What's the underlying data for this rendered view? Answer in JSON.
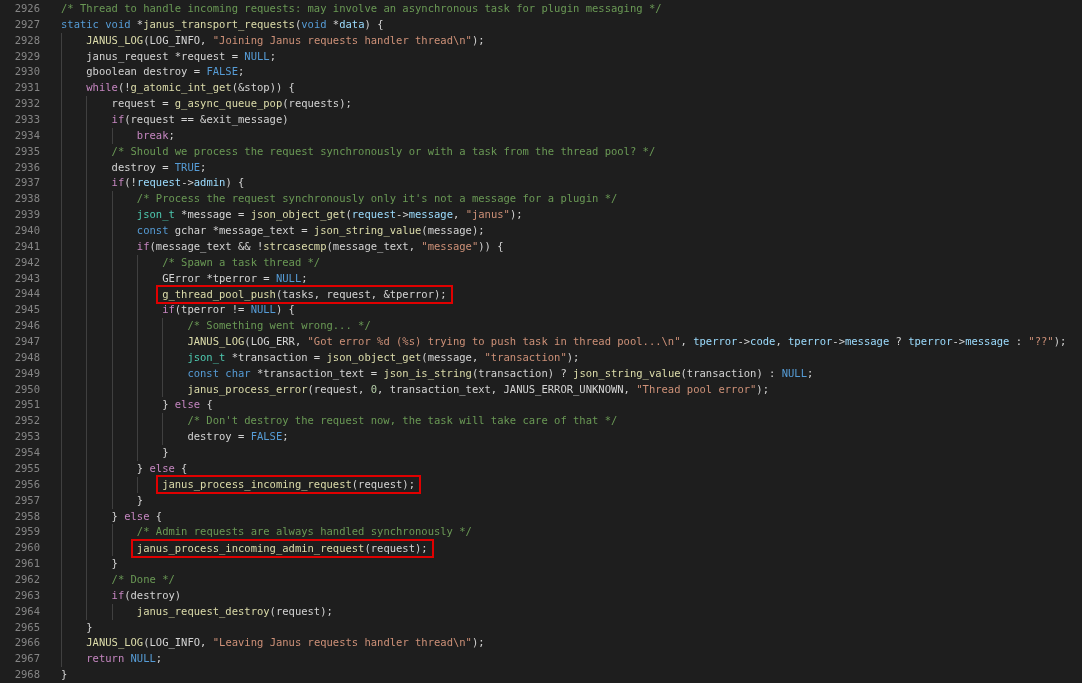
{
  "editor": {
    "lines": [
      {
        "number": "2926",
        "boxed": false,
        "tokens": [
          {
            "kind": "comment",
            "text": "/* Thread to handle incoming requests: may involve an asynchronous task for plugin messaging */"
          }
        ]
      },
      {
        "number": "2927",
        "boxed": false,
        "tokens": [
          {
            "kind": "keyword",
            "text": "static void"
          },
          {
            "kind": "plain",
            "text": " *"
          },
          {
            "kind": "function",
            "text": "janus_transport_requests"
          },
          {
            "kind": "plain",
            "text": "("
          },
          {
            "kind": "keyword",
            "text": "void"
          },
          {
            "kind": "plain",
            "text": " *"
          },
          {
            "kind": "member",
            "text": "data"
          },
          {
            "kind": "plain",
            "text": ") {"
          }
        ],
        "children": [
          {
            "number": "2928",
            "boxed": false,
            "tokens": [
              {
                "kind": "function",
                "text": "JANUS_LOG"
              },
              {
                "kind": "plain",
                "text": "(LOG_INFO, "
              },
              {
                "kind": "string",
                "text": "\"Joining Janus requests handler thread\\n\""
              },
              {
                "kind": "plain",
                "text": ");"
              }
            ]
          },
          {
            "number": "2929",
            "boxed": false,
            "tokens": [
              {
                "kind": "plain",
                "text": "janus_request *request = "
              },
              {
                "kind": "keyword",
                "text": "NULL"
              },
              {
                "kind": "plain",
                "text": ";"
              }
            ]
          },
          {
            "number": "2930",
            "boxed": false,
            "tokens": [
              {
                "kind": "plain",
                "text": "gboolean destroy = "
              },
              {
                "kind": "keyword",
                "text": "FALSE"
              },
              {
                "kind": "plain",
                "text": ";"
              }
            ]
          },
          {
            "number": "2931",
            "boxed": false,
            "tokens": [
              {
                "kind": "control",
                "text": "while"
              },
              {
                "kind": "plain",
                "text": "(!"
              },
              {
                "kind": "function",
                "text": "g_atomic_int_get"
              },
              {
                "kind": "plain",
                "text": "(&stop)) {"
              }
            ],
            "children": [
              {
                "number": "2932",
                "boxed": false,
                "tokens": [
                  {
                    "kind": "plain",
                    "text": "request = "
                  },
                  {
                    "kind": "function",
                    "text": "g_async_queue_pop"
                  },
                  {
                    "kind": "plain",
                    "text": "(requests);"
                  }
                ]
              },
              {
                "number": "2933",
                "boxed": false,
                "tokens": [
                  {
                    "kind": "control",
                    "text": "if"
                  },
                  {
                    "kind": "plain",
                    "text": "(request == &exit_message)"
                  }
                ],
                "children": [
                  {
                    "number": "2934",
                    "boxed": false,
                    "tokens": [
                      {
                        "kind": "control",
                        "text": "break"
                      },
                      {
                        "kind": "plain",
                        "text": ";"
                      }
                    ]
                  }
                ]
              },
              {
                "number": "2935",
                "boxed": false,
                "tokens": [
                  {
                    "kind": "comment",
                    "text": "/* Should we process the request synchronously or with a task from the thread pool? */"
                  }
                ]
              },
              {
                "number": "2936",
                "boxed": false,
                "tokens": [
                  {
                    "kind": "plain",
                    "text": "destroy = "
                  },
                  {
                    "kind": "keyword",
                    "text": "TRUE"
                  },
                  {
                    "kind": "plain",
                    "text": ";"
                  }
                ]
              },
              {
                "number": "2937",
                "boxed": false,
                "tokens": [
                  {
                    "kind": "control",
                    "text": "if"
                  },
                  {
                    "kind": "plain",
                    "text": "(!"
                  },
                  {
                    "kind": "member",
                    "text": "request"
                  },
                  {
                    "kind": "plain",
                    "text": "->"
                  },
                  {
                    "kind": "member",
                    "text": "admin"
                  },
                  {
                    "kind": "plain",
                    "text": ") {"
                  }
                ],
                "children": [
                  {
                    "number": "2938",
                    "boxed": false,
                    "tokens": [
                      {
                        "kind": "comment",
                        "text": "/* Process the request synchronously only it's not a message for a plugin */"
                      }
                    ]
                  },
                  {
                    "number": "2939",
                    "boxed": false,
                    "tokens": [
                      {
                        "kind": "type",
                        "text": "json_t"
                      },
                      {
                        "kind": "plain",
                        "text": " *message = "
                      },
                      {
                        "kind": "function",
                        "text": "json_object_get"
                      },
                      {
                        "kind": "plain",
                        "text": "("
                      },
                      {
                        "kind": "member",
                        "text": "request"
                      },
                      {
                        "kind": "plain",
                        "text": "->"
                      },
                      {
                        "kind": "member",
                        "text": "message"
                      },
                      {
                        "kind": "plain",
                        "text": ", "
                      },
                      {
                        "kind": "string",
                        "text": "\"janus\""
                      },
                      {
                        "kind": "plain",
                        "text": ");"
                      }
                    ]
                  },
                  {
                    "number": "2940",
                    "boxed": false,
                    "tokens": [
                      {
                        "kind": "keyword",
                        "text": "const"
                      },
                      {
                        "kind": "plain",
                        "text": " gchar *message_text = "
                      },
                      {
                        "kind": "function",
                        "text": "json_string_value"
                      },
                      {
                        "kind": "plain",
                        "text": "(message);"
                      }
                    ]
                  },
                  {
                    "number": "2941",
                    "boxed": false,
                    "tokens": [
                      {
                        "kind": "control",
                        "text": "if"
                      },
                      {
                        "kind": "plain",
                        "text": "(message_text && !"
                      },
                      {
                        "kind": "function",
                        "text": "strcasecmp"
                      },
                      {
                        "kind": "plain",
                        "text": "(message_text, "
                      },
                      {
                        "kind": "string",
                        "text": "\"message\""
                      },
                      {
                        "kind": "plain",
                        "text": ")) {"
                      }
                    ],
                    "children": [
                      {
                        "number": "2942",
                        "boxed": false,
                        "tokens": [
                          {
                            "kind": "comment",
                            "text": "/* Spawn a task thread */"
                          }
                        ]
                      },
                      {
                        "number": "2943",
                        "boxed": false,
                        "tokens": [
                          {
                            "kind": "plain",
                            "text": "GError *tperror = "
                          },
                          {
                            "kind": "keyword",
                            "text": "NULL"
                          },
                          {
                            "kind": "plain",
                            "text": ";"
                          }
                        ]
                      },
                      {
                        "number": "2944",
                        "boxed": true,
                        "tokens": [
                          {
                            "kind": "function",
                            "text": "g_thread_pool_push"
                          },
                          {
                            "kind": "plain",
                            "text": "(tasks, request, &tperror);"
                          }
                        ]
                      },
                      {
                        "number": "2945",
                        "boxed": false,
                        "tokens": [
                          {
                            "kind": "control",
                            "text": "if"
                          },
                          {
                            "kind": "plain",
                            "text": "(tperror != "
                          },
                          {
                            "kind": "keyword",
                            "text": "NULL"
                          },
                          {
                            "kind": "plain",
                            "text": ") {"
                          }
                        ],
                        "children": [
                          {
                            "number": "2946",
                            "boxed": false,
                            "tokens": [
                              {
                                "kind": "comment",
                                "text": "/* Something went wrong... */"
                              }
                            ]
                          },
                          {
                            "number": "2947",
                            "boxed": false,
                            "tokens": [
                              {
                                "kind": "function",
                                "text": "JANUS_LOG"
                              },
                              {
                                "kind": "plain",
                                "text": "(LOG_ERR, "
                              },
                              {
                                "kind": "string",
                                "text": "\"Got error %d (%s) trying to push task in thread pool...\\n\""
                              },
                              {
                                "kind": "plain",
                                "text": ", "
                              },
                              {
                                "kind": "member",
                                "text": "tperror"
                              },
                              {
                                "kind": "plain",
                                "text": "->"
                              },
                              {
                                "kind": "member",
                                "text": "code"
                              },
                              {
                                "kind": "plain",
                                "text": ", "
                              },
                              {
                                "kind": "member",
                                "text": "tperror"
                              },
                              {
                                "kind": "plain",
                                "text": "->"
                              },
                              {
                                "kind": "member",
                                "text": "message"
                              },
                              {
                                "kind": "plain",
                                "text": " ? "
                              },
                              {
                                "kind": "member",
                                "text": "tperror"
                              },
                              {
                                "kind": "plain",
                                "text": "->"
                              },
                              {
                                "kind": "member",
                                "text": "message"
                              },
                              {
                                "kind": "plain",
                                "text": " : "
                              },
                              {
                                "kind": "string",
                                "text": "\"??\""
                              },
                              {
                                "kind": "plain",
                                "text": ");"
                              }
                            ]
                          },
                          {
                            "number": "2948",
                            "boxed": false,
                            "tokens": [
                              {
                                "kind": "type",
                                "text": "json_t"
                              },
                              {
                                "kind": "plain",
                                "text": " *transaction = "
                              },
                              {
                                "kind": "function",
                                "text": "json_object_get"
                              },
                              {
                                "kind": "plain",
                                "text": "(message, "
                              },
                              {
                                "kind": "string",
                                "text": "\"transaction\""
                              },
                              {
                                "kind": "plain",
                                "text": ");"
                              }
                            ]
                          },
                          {
                            "number": "2949",
                            "boxed": false,
                            "tokens": [
                              {
                                "kind": "keyword",
                                "text": "const char"
                              },
                              {
                                "kind": "plain",
                                "text": " *transaction_text = "
                              },
                              {
                                "kind": "function",
                                "text": "json_is_string"
                              },
                              {
                                "kind": "plain",
                                "text": "(transaction) ? "
                              },
                              {
                                "kind": "function",
                                "text": "json_string_value"
                              },
                              {
                                "kind": "plain",
                                "text": "(transaction) : "
                              },
                              {
                                "kind": "keyword",
                                "text": "NULL"
                              },
                              {
                                "kind": "plain",
                                "text": ";"
                              }
                            ]
                          },
                          {
                            "number": "2950",
                            "boxed": false,
                            "tokens": [
                              {
                                "kind": "function",
                                "text": "janus_process_error"
                              },
                              {
                                "kind": "plain",
                                "text": "(request, "
                              },
                              {
                                "kind": "number",
                                "text": "0"
                              },
                              {
                                "kind": "plain",
                                "text": ", transaction_text, JANUS_ERROR_UNKNOWN, "
                              },
                              {
                                "kind": "string",
                                "text": "\"Thread pool error\""
                              },
                              {
                                "kind": "plain",
                                "text": ");"
                              }
                            ]
                          }
                        ]
                      },
                      {
                        "number": "2951",
                        "boxed": false,
                        "tokens": [
                          {
                            "kind": "plain",
                            "text": "} "
                          },
                          {
                            "kind": "control",
                            "text": "else"
                          },
                          {
                            "kind": "plain",
                            "text": " {"
                          }
                        ],
                        "children": [
                          {
                            "number": "2952",
                            "boxed": false,
                            "tokens": [
                              {
                                "kind": "comment",
                                "text": "/* Don't destroy the request now, the task will take care of that */"
                              }
                            ]
                          },
                          {
                            "number": "2953",
                            "boxed": false,
                            "tokens": [
                              {
                                "kind": "plain",
                                "text": "destroy = "
                              },
                              {
                                "kind": "keyword",
                                "text": "FALSE"
                              },
                              {
                                "kind": "plain",
                                "text": ";"
                              }
                            ]
                          }
                        ]
                      },
                      {
                        "number": "2954",
                        "boxed": false,
                        "tokens": [
                          {
                            "kind": "plain",
                            "text": "}"
                          }
                        ]
                      }
                    ]
                  },
                  {
                    "number": "2955",
                    "boxed": false,
                    "tokens": [
                      {
                        "kind": "plain",
                        "text": "} "
                      },
                      {
                        "kind": "control",
                        "text": "else"
                      },
                      {
                        "kind": "plain",
                        "text": " {"
                      }
                    ],
                    "children": [
                      {
                        "number": "2956",
                        "boxed": true,
                        "tokens": [
                          {
                            "kind": "function",
                            "text": "janus_process_incoming_request"
                          },
                          {
                            "kind": "plain",
                            "text": "(request);"
                          }
                        ]
                      }
                    ]
                  },
                  {
                    "number": "2957",
                    "boxed": false,
                    "tokens": [
                      {
                        "kind": "plain",
                        "text": "}"
                      }
                    ]
                  }
                ]
              },
              {
                "number": "2958",
                "boxed": false,
                "tokens": [
                  {
                    "kind": "plain",
                    "text": "} "
                  },
                  {
                    "kind": "control",
                    "text": "else"
                  },
                  {
                    "kind": "plain",
                    "text": " {"
                  }
                ],
                "children": [
                  {
                    "number": "2959",
                    "boxed": false,
                    "tokens": [
                      {
                        "kind": "comment",
                        "text": "/* Admin requests are always handled synchronously */"
                      }
                    ]
                  },
                  {
                    "number": "2960",
                    "boxed": true,
                    "tokens": [
                      {
                        "kind": "function",
                        "text": "janus_process_incoming_admin_request"
                      },
                      {
                        "kind": "plain",
                        "text": "(request);"
                      }
                    ]
                  }
                ]
              },
              {
                "number": "2961",
                "boxed": false,
                "tokens": [
                  {
                    "kind": "plain",
                    "text": "}"
                  }
                ]
              },
              {
                "number": "2962",
                "boxed": false,
                "tokens": [
                  {
                    "kind": "comment",
                    "text": "/* Done */"
                  }
                ]
              },
              {
                "number": "2963",
                "boxed": false,
                "tokens": [
                  {
                    "kind": "control",
                    "text": "if"
                  },
                  {
                    "kind": "plain",
                    "text": "(destroy)"
                  }
                ],
                "children": [
                  {
                    "number": "2964",
                    "boxed": false,
                    "tokens": [
                      {
                        "kind": "function",
                        "text": "janus_request_destroy"
                      },
                      {
                        "kind": "plain",
                        "text": "(request);"
                      }
                    ]
                  }
                ]
              }
            ]
          },
          {
            "number": "2965",
            "boxed": false,
            "tokens": [
              {
                "kind": "plain",
                "text": "}"
              }
            ]
          },
          {
            "number": "2966",
            "boxed": false,
            "tokens": [
              {
                "kind": "function",
                "text": "JANUS_LOG"
              },
              {
                "kind": "plain",
                "text": "(LOG_INFO, "
              },
              {
                "kind": "string",
                "text": "\"Leaving Janus requests handler thread\\n\""
              },
              {
                "kind": "plain",
                "text": ");"
              }
            ]
          },
          {
            "number": "2967",
            "boxed": false,
            "tokens": [
              {
                "kind": "control",
                "text": "return"
              },
              {
                "kind": "keyword",
                "text": " NULL"
              },
              {
                "kind": "plain",
                "text": ";"
              }
            ]
          }
        ]
      },
      {
        "number": "2968",
        "boxed": false,
        "tokens": [
          {
            "kind": "plain",
            "text": "}"
          }
        ]
      }
    ]
  }
}
